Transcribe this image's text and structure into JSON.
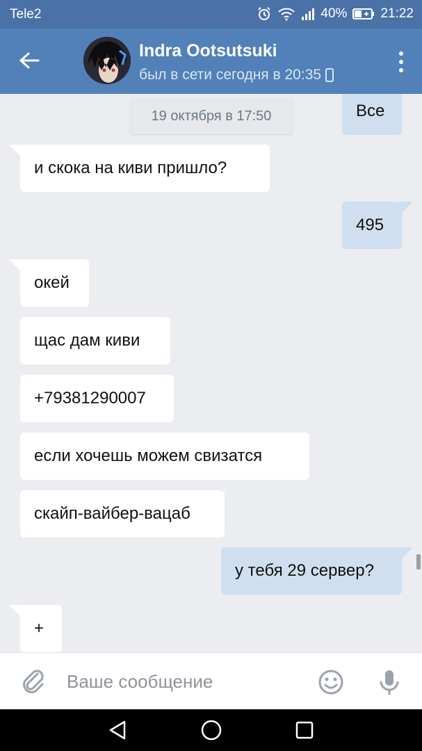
{
  "status_bar": {
    "carrier": "Tele2",
    "battery": "40%",
    "time": "21:22"
  },
  "header": {
    "contact_name": "Indra Ootsutsuki",
    "contact_status": "был в сети сегодня в 20:35",
    "accent_color": "#5181b8"
  },
  "chat": {
    "date_separator": "19 октября в 17:50",
    "messages": [
      {
        "direction": "out",
        "text": "Все"
      },
      {
        "direction": "in",
        "text": "и скока на киви пришло?"
      },
      {
        "direction": "out",
        "text": "495"
      },
      {
        "direction": "in",
        "text": "окей"
      },
      {
        "direction": "in",
        "text": "щас дам киви"
      },
      {
        "direction": "in",
        "text": "+79381290007"
      },
      {
        "direction": "in",
        "text": "если хочешь можем свизатся"
      },
      {
        "direction": "in",
        "text": "скайп-вайбер-вацаб"
      },
      {
        "direction": "out",
        "text": "у тебя 29 сервер?"
      },
      {
        "direction": "in",
        "text": "+"
      }
    ]
  },
  "composer": {
    "placeholder": "Ваше сообщение"
  },
  "icons": {
    "alarm": "alarm-icon",
    "wifi": "wifi-icon",
    "signal": "signal-icon",
    "battery": "battery-icon",
    "back": "arrow-left-icon",
    "menu": "more-vertical-icon",
    "mobile": "mobile-device-icon",
    "attach": "paperclip-icon",
    "emoji": "smiley-icon",
    "mic": "microphone-icon",
    "nav_back": "triangle-back-icon",
    "nav_home": "circle-home-icon",
    "nav_recent": "square-recent-icon"
  }
}
